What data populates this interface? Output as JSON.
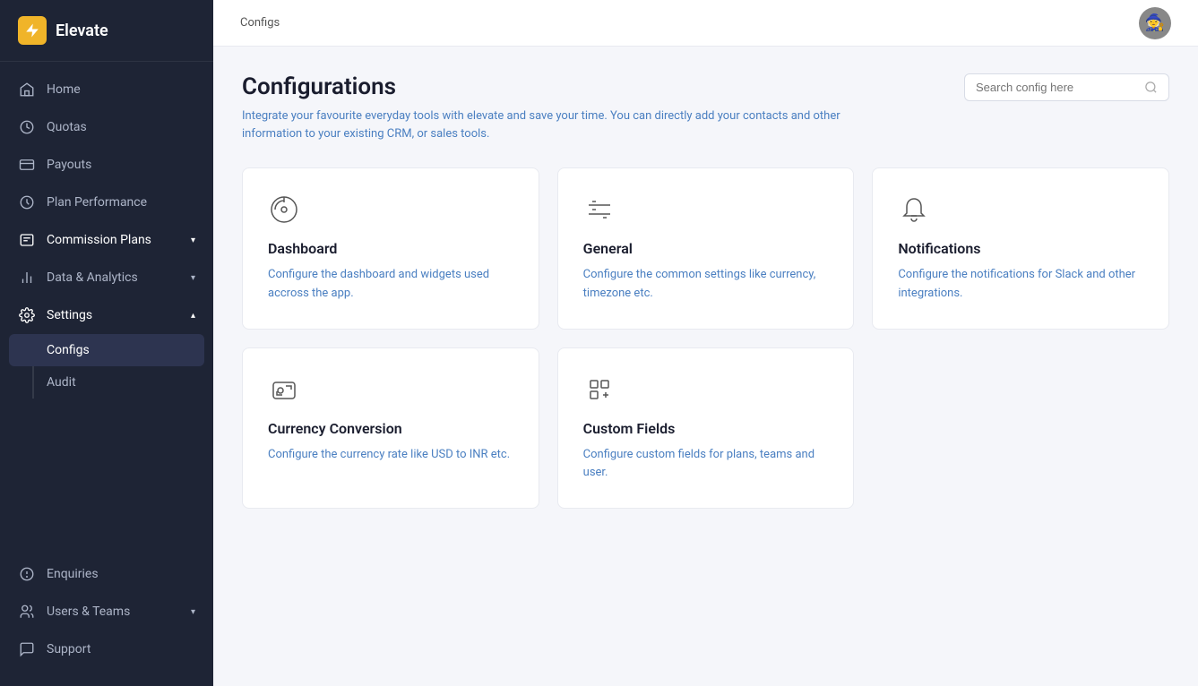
{
  "app": {
    "name": "Elevate",
    "logo_symbol": "⚡"
  },
  "breadcrumb": "Configs",
  "page": {
    "title": "Configurations",
    "description": "Integrate your favourite everyday tools with elevate and save your time. You can directly add your contacts and other information to your existing CRM, or sales tools."
  },
  "search": {
    "placeholder": "Search config here"
  },
  "nav": {
    "items": [
      {
        "id": "home",
        "label": "Home",
        "icon": "home-icon"
      },
      {
        "id": "quotas",
        "label": "Quotas",
        "icon": "quotas-icon"
      },
      {
        "id": "payouts",
        "label": "Payouts",
        "icon": "payouts-icon"
      },
      {
        "id": "plan-performance",
        "label": "Plan Performance",
        "icon": "plan-icon"
      },
      {
        "id": "commission-plans",
        "label": "Commission Plans",
        "icon": "commission-icon",
        "has_arrow": true
      },
      {
        "id": "data-analytics",
        "label": "Data & Analytics",
        "icon": "analytics-icon",
        "has_arrow": true
      },
      {
        "id": "settings",
        "label": "Settings",
        "icon": "settings-icon",
        "has_arrow": true,
        "expanded": true
      }
    ],
    "settings_sub": [
      {
        "id": "configs",
        "label": "Configs",
        "active": true
      },
      {
        "id": "audit",
        "label": "Audit",
        "active": false
      }
    ],
    "bottom_items": [
      {
        "id": "enquiries",
        "label": "Enquiries",
        "icon": "enquiries-icon"
      },
      {
        "id": "users-teams",
        "label": "Users & Teams",
        "icon": "users-icon",
        "has_arrow": true
      },
      {
        "id": "support",
        "label": "Support",
        "icon": "support-icon"
      }
    ]
  },
  "cards": [
    {
      "id": "dashboard",
      "title": "Dashboard",
      "description": "Configure the dashboard and widgets used accross the app.",
      "icon": "dashboard-icon"
    },
    {
      "id": "general",
      "title": "General",
      "description": "Configure the common settings like currency, timezone etc.",
      "icon": "general-icon"
    },
    {
      "id": "notifications",
      "title": "Notifications",
      "description": "Configure the notifications for Slack and other integrations.",
      "icon": "notifications-icon"
    },
    {
      "id": "currency-conversion",
      "title": "Currency Conversion",
      "description": "Configure the currency rate like USD to INR etc.",
      "icon": "currency-icon"
    },
    {
      "id": "custom-fields",
      "title": "Custom Fields",
      "description": "Configure custom fields for plans, teams and user.",
      "icon": "custom-fields-icon"
    }
  ]
}
